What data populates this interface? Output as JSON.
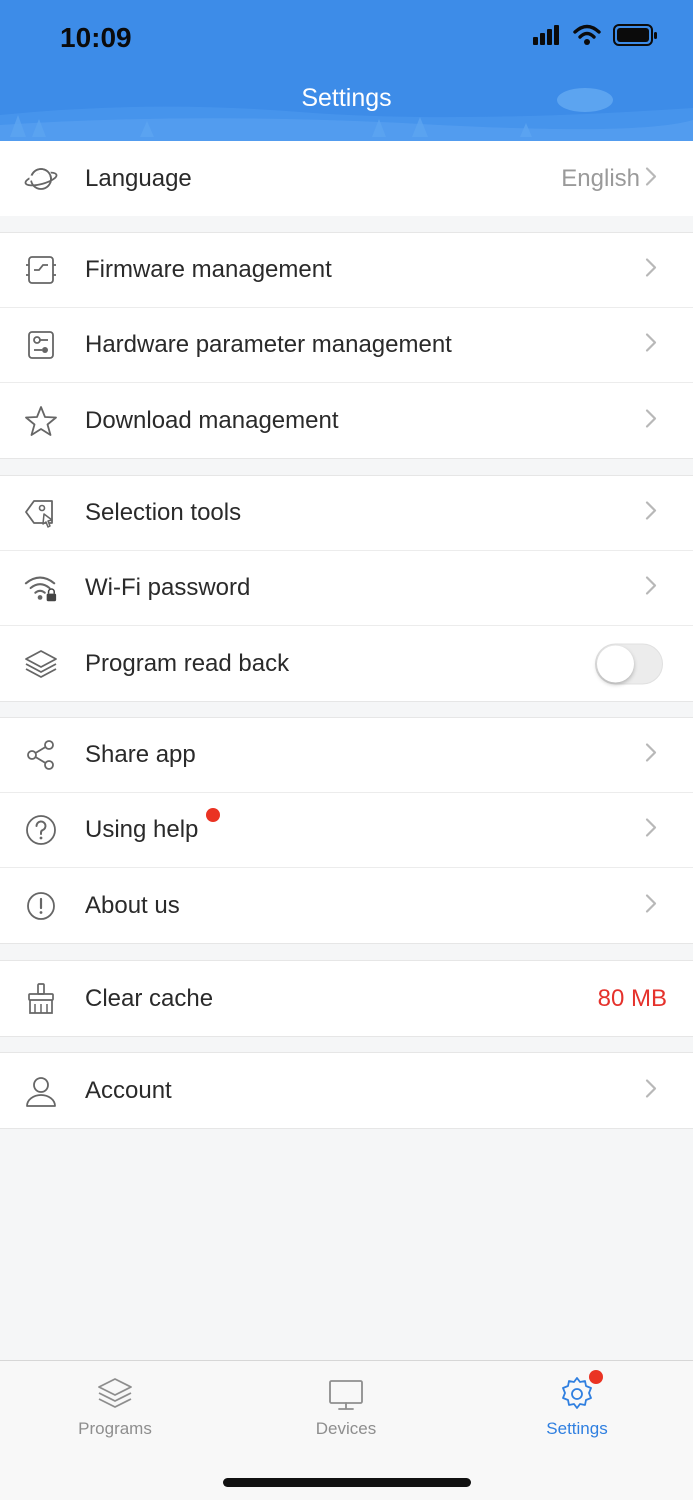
{
  "status_bar": {
    "time": "10:09"
  },
  "header": {
    "title": "Settings"
  },
  "groups": {
    "language": {
      "label": "Language",
      "value": "English"
    },
    "management": [
      {
        "label": "Firmware management",
        "icon": "firmware-icon"
      },
      {
        "label": "Hardware parameter management",
        "icon": "hardware-params-icon"
      },
      {
        "label": "Download management",
        "icon": "star-icon"
      }
    ],
    "tools": [
      {
        "label": "Selection tools",
        "icon": "tag-cursor-icon"
      },
      {
        "label": "Wi-Fi password",
        "icon": "wifi-lock-icon"
      },
      {
        "label": "Program read back",
        "icon": "layers-icon",
        "toggle": false
      }
    ],
    "info": [
      {
        "label": "Share app",
        "icon": "share-icon"
      },
      {
        "label": "Using help",
        "icon": "question-circle-icon",
        "badge": true
      },
      {
        "label": "About us",
        "icon": "info-circle-icon"
      }
    ],
    "cache": {
      "label": "Clear cache",
      "value": "80 MB"
    },
    "account": {
      "label": "Account",
      "icon": "user-icon"
    }
  },
  "tabbar": {
    "programs": "Programs",
    "devices": "Devices",
    "settings": "Settings",
    "active": "settings"
  },
  "colors": {
    "header_bg": "#3d8ce8",
    "accent": "#2f7fe0",
    "badge": "#ea3323",
    "cache_value": "#e5322c"
  }
}
